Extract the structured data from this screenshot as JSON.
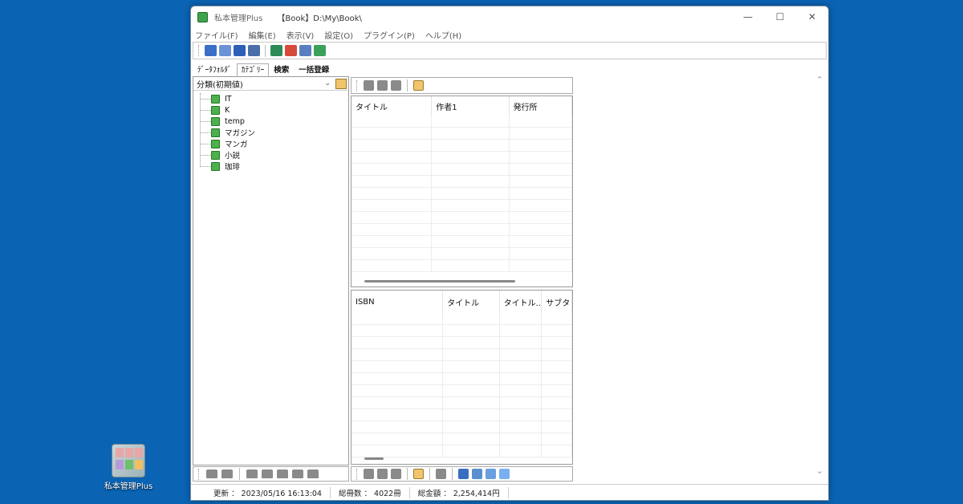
{
  "window": {
    "app_title": "私本管理Plus",
    "path": "【Book】D:\\My\\Book\\"
  },
  "menu": [
    "ファイル(F)",
    "編集(E)",
    "表示(V)",
    "設定(O)",
    "プラグイン(P)",
    "ヘルプ(H)"
  ],
  "left_tabs": [
    "ﾃﾞｰﾀﾌｫﾙﾀﾞ",
    "ｶﾃｺﾞﾘｰ",
    "検索",
    "一括登録"
  ],
  "category_select": "分類(初期値)",
  "tree_items": [
    "IT",
    "K",
    "temp",
    "マガジン",
    "マンガ",
    "小説",
    "珈琲"
  ],
  "upper_grid_columns": [
    "タイトル",
    "作者1",
    "発行所"
  ],
  "lower_grid_columns": [
    "ISBN",
    "タイトル",
    "タイトル...",
    "サブタ"
  ],
  "status": {
    "updated": "更新 ： 2023/05/16 16:13:04",
    "total_books": "総冊数 ： 4022冊",
    "total_amount": "総金額 ： 2,254,414円"
  },
  "desktop_icon_label": "私本管理Plus",
  "colors": {
    "desktop": "#0a63b3",
    "accent_green": "#3fa34d"
  }
}
